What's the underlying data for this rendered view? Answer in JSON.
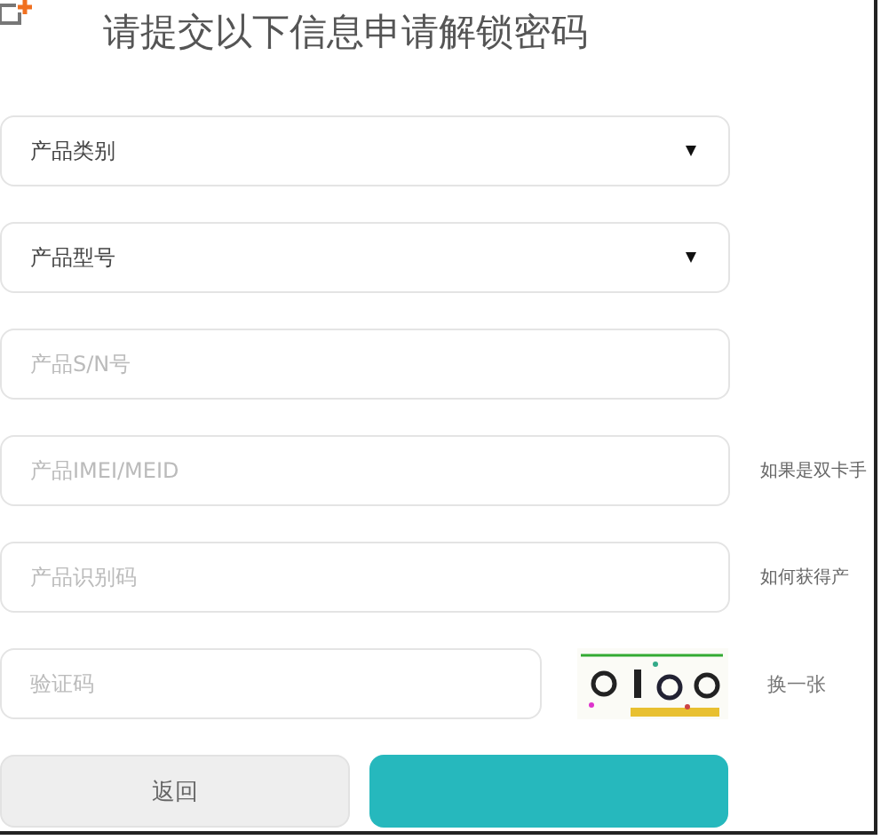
{
  "title": "请提交以下信息申请解锁密码",
  "fields": [
    {
      "kind": "select",
      "value": "产品类别"
    },
    {
      "kind": "select",
      "value": "产品型号"
    },
    {
      "kind": "input",
      "placeholder": "产品S/N号"
    },
    {
      "kind": "input",
      "placeholder": "产品IMEI/MEID",
      "hint": "如果是双卡手"
    },
    {
      "kind": "input",
      "placeholder": "产品识别码",
      "hint": "如何获得产"
    },
    {
      "kind": "captcha",
      "placeholder": "验证码",
      "refresh": "换一张"
    }
  ],
  "buttons": [
    {
      "kind": "secondary",
      "label": "返回"
    },
    {
      "kind": "primary"
    }
  ]
}
